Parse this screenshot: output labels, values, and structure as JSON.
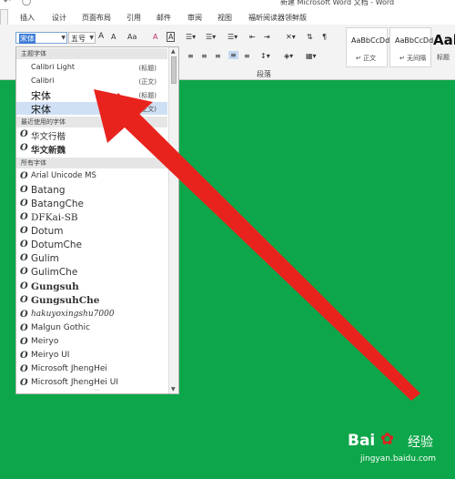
{
  "window": {
    "title": "新建 Microsoft Word 文档 - Word",
    "qa_icons": [
      "undo-icon",
      "redo-icon"
    ]
  },
  "tabs": [
    "插入",
    "设计",
    "页面布局",
    "引用",
    "邮件",
    "审阅",
    "视图",
    "福昕阅读器领鲜版"
  ],
  "ribbon": {
    "font_name": "宋体",
    "font_size": "五号",
    "grow_font": "A",
    "shrink_font": "A",
    "change_case": "Aa",
    "clear_format": "A",
    "char_border": "A",
    "paragraph_label": "段落",
    "styles": [
      {
        "sample": "AaBbCcDd",
        "name": "↵ 正文"
      },
      {
        "sample": "AaBbCcDd",
        "name": "↵ 无间隔"
      },
      {
        "sample": "Aal",
        "name": "标题"
      }
    ]
  },
  "dropdown": {
    "theme_header": "主题字体",
    "theme_fonts": [
      {
        "name": "Calibri Light",
        "tag": "(标题)"
      },
      {
        "name": "Calibri",
        "tag": "(正文)"
      },
      {
        "name": "宋体",
        "tag": "(标题)"
      },
      {
        "name": "宋体",
        "tag": "(正文)"
      }
    ],
    "recent_header": "最近使用的字体",
    "recent_fonts": [
      "华文行楷",
      "华文新魏"
    ],
    "all_header": "所有字体",
    "all_fonts": [
      "Arial Unicode MS",
      "Batang",
      "BatangChe",
      "DFKai-SB",
      "Dotum",
      "DotumChe",
      "Gulim",
      "GulimChe",
      "Gungsuh",
      "GungsuhChe",
      "hakuyoxingshu7000",
      "Malgun Gothic",
      "Meiryo",
      "Meiryo UI",
      "Microsoft JhengHei",
      "Microsoft JhengHei UI"
    ]
  },
  "colors": {
    "document_bg": "#0ea64a",
    "arrow": "#e8231e",
    "selection": "#cfe0f4"
  },
  "watermark": {
    "brand": "Bai",
    "brand_cn": "经验",
    "url": "jingyan.baidu.com"
  }
}
